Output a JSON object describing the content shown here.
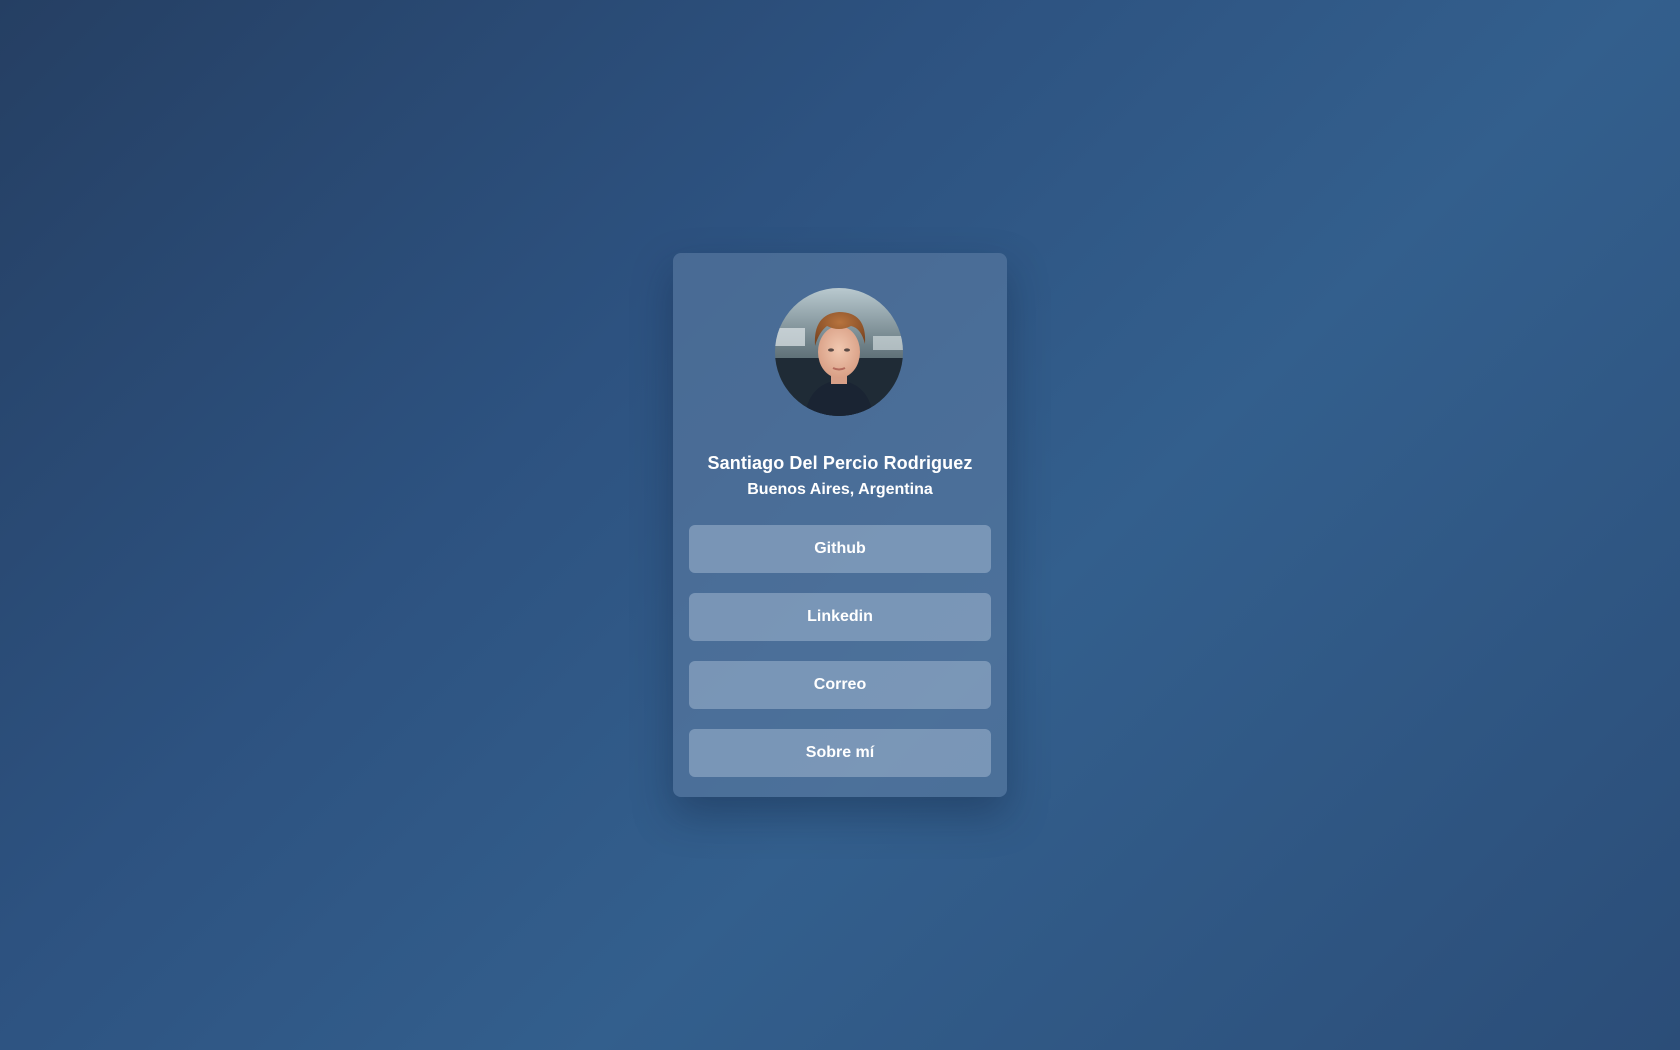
{
  "profile": {
    "name": "Santiago Del Percio Rodriguez",
    "location": "Buenos Aires, Argentina",
    "avatar_icon": "profile-photo"
  },
  "links": [
    {
      "label": "Github"
    },
    {
      "label": "Linkedin"
    },
    {
      "label": "Correo"
    },
    {
      "label": "Sobre mí"
    }
  ],
  "colors": {
    "background_start": "#253f63",
    "background_mid": "#335f8d",
    "card": "#4d6f98",
    "button": "#7390b2",
    "text": "#ffffff"
  }
}
